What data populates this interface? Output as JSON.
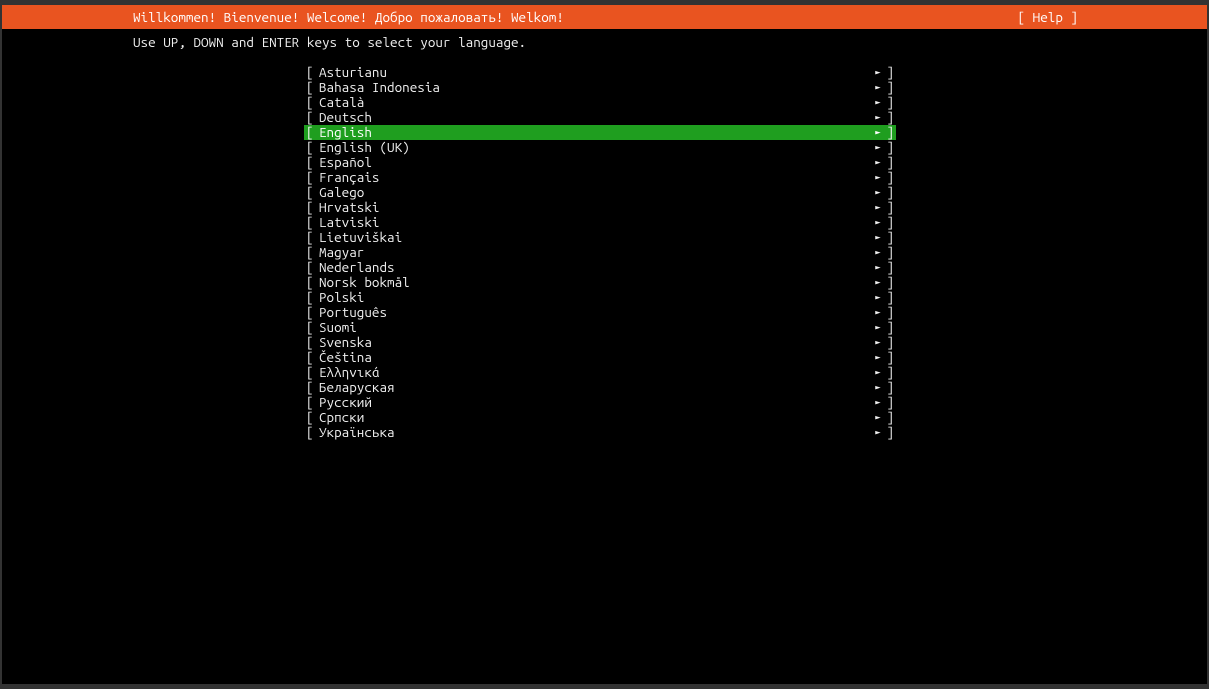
{
  "colors": {
    "header_bg": "#e95420",
    "selected_bg": "#1f9e1f",
    "text": "#f0f0f0",
    "bg": "#000000"
  },
  "header": {
    "title": "Willkommen! Bienvenue! Welcome! Добро пожаловать! Welkom!",
    "help_label": "[ Help ]"
  },
  "instruction": "Use UP, DOWN and ENTER keys to select your language.",
  "arrow": "►",
  "bracket_open": "[",
  "bracket_close": "]",
  "selected_index": 4,
  "languages": [
    {
      "name": "Asturianu"
    },
    {
      "name": "Bahasa Indonesia"
    },
    {
      "name": "Català"
    },
    {
      "name": "Deutsch"
    },
    {
      "name": "English"
    },
    {
      "name": "English (UK)"
    },
    {
      "name": "Español"
    },
    {
      "name": "Français"
    },
    {
      "name": "Galego"
    },
    {
      "name": "Hrvatski"
    },
    {
      "name": "Latviski"
    },
    {
      "name": "Lietuviškai"
    },
    {
      "name": "Magyar"
    },
    {
      "name": "Nederlands"
    },
    {
      "name": "Norsk bokmål"
    },
    {
      "name": "Polski"
    },
    {
      "name": "Português"
    },
    {
      "name": "Suomi"
    },
    {
      "name": "Svenska"
    },
    {
      "name": "Čeština"
    },
    {
      "name": "Ελληνικά"
    },
    {
      "name": "Беларуская"
    },
    {
      "name": "Русский"
    },
    {
      "name": "Српски"
    },
    {
      "name": "Українська"
    }
  ]
}
